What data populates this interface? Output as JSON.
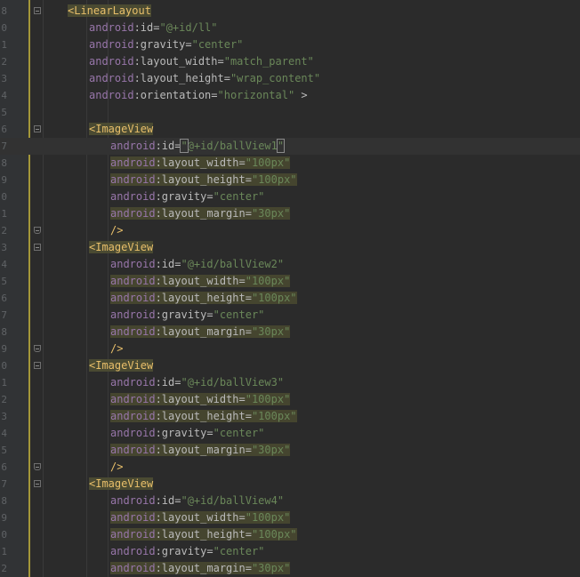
{
  "lines": [
    {
      "n": "8",
      "tokens": [
        {
          "t": "<LinearLayout",
          "c": "tag hl"
        }
      ],
      "indent": 1,
      "fold": "start"
    },
    {
      "n": "0",
      "tokens": [
        {
          "t": "android",
          "c": "ns"
        },
        {
          "t": ":id=",
          "c": "attr"
        },
        {
          "t": "\"@+id/ll\"",
          "c": "val"
        }
      ],
      "indent": 2
    },
    {
      "n": "1",
      "tokens": [
        {
          "t": "android",
          "c": "ns"
        },
        {
          "t": ":gravity=",
          "c": "attr"
        },
        {
          "t": "\"center\"",
          "c": "val"
        }
      ],
      "indent": 2
    },
    {
      "n": "2",
      "tokens": [
        {
          "t": "android",
          "c": "ns"
        },
        {
          "t": ":layout_width=",
          "c": "attr"
        },
        {
          "t": "\"match_parent\"",
          "c": "val"
        }
      ],
      "indent": 2
    },
    {
      "n": "3",
      "tokens": [
        {
          "t": "android",
          "c": "ns"
        },
        {
          "t": ":layout_height=",
          "c": "attr"
        },
        {
          "t": "\"wrap_content\"",
          "c": "val"
        }
      ],
      "indent": 2
    },
    {
      "n": "4",
      "tokens": [
        {
          "t": "android",
          "c": "ns"
        },
        {
          "t": ":orientation=",
          "c": "attr"
        },
        {
          "t": "\"horizontal\"",
          "c": "val"
        },
        {
          "t": " >",
          "c": "punct"
        }
      ],
      "indent": 2
    },
    {
      "n": "5",
      "tokens": [],
      "indent": 0
    },
    {
      "n": "6",
      "tokens": [
        {
          "t": "<ImageView",
          "c": "tag hl"
        }
      ],
      "indent": 2,
      "fold": "start"
    },
    {
      "n": "7",
      "tokens": [
        {
          "t": "android",
          "c": "ns"
        },
        {
          "t": ":id=",
          "c": "attr"
        },
        {
          "t": "\"",
          "c": "val caretbox"
        },
        {
          "t": "@+id/ballView1",
          "c": "val"
        },
        {
          "t": "\"",
          "c": "val caretbox"
        }
      ],
      "indent": 3,
      "current": true
    },
    {
      "n": "8",
      "tokens": [
        {
          "t": "android",
          "c": "ns hlbg"
        },
        {
          "t": ":layout_width=",
          "c": "attr hlbg"
        },
        {
          "t": "\"100px\"",
          "c": "val hlbg"
        }
      ],
      "indent": 3
    },
    {
      "n": "9",
      "tokens": [
        {
          "t": "android",
          "c": "ns hlbg"
        },
        {
          "t": ":layout_height=",
          "c": "attr hlbg"
        },
        {
          "t": "\"100px\"",
          "c": "val hlbg"
        }
      ],
      "indent": 3
    },
    {
      "n": "0",
      "tokens": [
        {
          "t": "android",
          "c": "ns"
        },
        {
          "t": ":gravity=",
          "c": "attr"
        },
        {
          "t": "\"center\"",
          "c": "val"
        }
      ],
      "indent": 3
    },
    {
      "n": "1",
      "tokens": [
        {
          "t": "android",
          "c": "ns hlbg"
        },
        {
          "t": ":layout_margin=",
          "c": "attr hlbg"
        },
        {
          "t": "\"30px\"",
          "c": "val hlbg"
        }
      ],
      "indent": 3
    },
    {
      "n": "2",
      "tokens": [
        {
          "t": "/>",
          "c": "tag"
        }
      ],
      "indent": 3,
      "fold": "end"
    },
    {
      "n": "3",
      "tokens": [
        {
          "t": "<ImageView",
          "c": "tag hl"
        }
      ],
      "indent": 2,
      "fold": "start"
    },
    {
      "n": "4",
      "tokens": [
        {
          "t": "android",
          "c": "ns"
        },
        {
          "t": ":id=",
          "c": "attr"
        },
        {
          "t": "\"@+id/ballView2\"",
          "c": "val"
        }
      ],
      "indent": 3
    },
    {
      "n": "5",
      "tokens": [
        {
          "t": "android",
          "c": "ns hlbg"
        },
        {
          "t": ":layout_width=",
          "c": "attr hlbg"
        },
        {
          "t": "\"100px\"",
          "c": "val hlbg"
        }
      ],
      "indent": 3
    },
    {
      "n": "6",
      "tokens": [
        {
          "t": "android",
          "c": "ns hlbg"
        },
        {
          "t": ":layout_height=",
          "c": "attr hlbg"
        },
        {
          "t": "\"100px\"",
          "c": "val hlbg"
        }
      ],
      "indent": 3
    },
    {
      "n": "7",
      "tokens": [
        {
          "t": "android",
          "c": "ns"
        },
        {
          "t": ":gravity=",
          "c": "attr"
        },
        {
          "t": "\"center\"",
          "c": "val"
        }
      ],
      "indent": 3
    },
    {
      "n": "8",
      "tokens": [
        {
          "t": "android",
          "c": "ns hlbg"
        },
        {
          "t": ":layout_margin=",
          "c": "attr hlbg"
        },
        {
          "t": "\"30px\"",
          "c": "val hlbg"
        }
      ],
      "indent": 3
    },
    {
      "n": "9",
      "tokens": [
        {
          "t": "/>",
          "c": "tag"
        }
      ],
      "indent": 3,
      "fold": "end"
    },
    {
      "n": "0",
      "tokens": [
        {
          "t": "<ImageView",
          "c": "tag hl"
        }
      ],
      "indent": 2,
      "fold": "start"
    },
    {
      "n": "1",
      "tokens": [
        {
          "t": "android",
          "c": "ns"
        },
        {
          "t": ":id=",
          "c": "attr"
        },
        {
          "t": "\"@+id/ballView3\"",
          "c": "val"
        }
      ],
      "indent": 3
    },
    {
      "n": "2",
      "tokens": [
        {
          "t": "android",
          "c": "ns hlbg"
        },
        {
          "t": ":layout_width=",
          "c": "attr hlbg"
        },
        {
          "t": "\"100px\"",
          "c": "val hlbg"
        }
      ],
      "indent": 3
    },
    {
      "n": "3",
      "tokens": [
        {
          "t": "android",
          "c": "ns hlbg"
        },
        {
          "t": ":layout_height=",
          "c": "attr hlbg"
        },
        {
          "t": "\"100px\"",
          "c": "val hlbg"
        }
      ],
      "indent": 3
    },
    {
      "n": "4",
      "tokens": [
        {
          "t": "android",
          "c": "ns"
        },
        {
          "t": ":gravity=",
          "c": "attr"
        },
        {
          "t": "\"center\"",
          "c": "val"
        }
      ],
      "indent": 3
    },
    {
      "n": "5",
      "tokens": [
        {
          "t": "android",
          "c": "ns hlbg"
        },
        {
          "t": ":layout_margin=",
          "c": "attr hlbg"
        },
        {
          "t": "\"30px\"",
          "c": "val hlbg"
        }
      ],
      "indent": 3
    },
    {
      "n": "6",
      "tokens": [
        {
          "t": "/>",
          "c": "tag"
        }
      ],
      "indent": 3,
      "fold": "end"
    },
    {
      "n": "7",
      "tokens": [
        {
          "t": "<ImageView",
          "c": "tag hl"
        }
      ],
      "indent": 2,
      "fold": "start"
    },
    {
      "n": "8",
      "tokens": [
        {
          "t": "android",
          "c": "ns"
        },
        {
          "t": ":id=",
          "c": "attr"
        },
        {
          "t": "\"@+id/ballView4\"",
          "c": "val"
        }
      ],
      "indent": 3
    },
    {
      "n": "9",
      "tokens": [
        {
          "t": "android",
          "c": "ns hlbg"
        },
        {
          "t": ":layout_width=",
          "c": "attr hlbg"
        },
        {
          "t": "\"100px\"",
          "c": "val hlbg"
        }
      ],
      "indent": 3
    },
    {
      "n": "0",
      "tokens": [
        {
          "t": "android",
          "c": "ns hlbg"
        },
        {
          "t": ":layout_height=",
          "c": "attr hlbg"
        },
        {
          "t": "\"100px\"",
          "c": "val hlbg"
        }
      ],
      "indent": 3
    },
    {
      "n": "1",
      "tokens": [
        {
          "t": "android",
          "c": "ns"
        },
        {
          "t": ":gravity=",
          "c": "attr"
        },
        {
          "t": "\"center\"",
          "c": "val"
        }
      ],
      "indent": 3
    },
    {
      "n": "2",
      "tokens": [
        {
          "t": "android",
          "c": "ns hlbg"
        },
        {
          "t": ":layout_margin=",
          "c": "attr hlbg"
        },
        {
          "t": "\"30px\"",
          "c": "val hlbg"
        }
      ],
      "indent": 3
    }
  ]
}
